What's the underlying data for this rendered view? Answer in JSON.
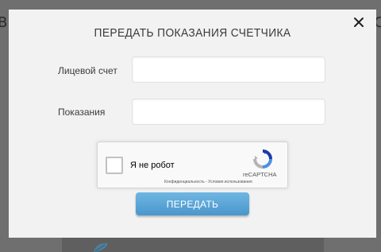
{
  "backdrop": {
    "left_fragment": "В",
    "right_fragment": "С"
  },
  "modal": {
    "title": "ПЕРЕДАТЬ ПОКАЗАНИЯ СЧЕТЧИКА",
    "close_icon": "close-icon",
    "fields": [
      {
        "label": "Лицевой счет",
        "value": "",
        "placeholder": ""
      },
      {
        "label": "Показания",
        "value": "",
        "placeholder": ""
      }
    ],
    "recaptcha": {
      "label": "Я не робот",
      "brand": "reCAPTCHA",
      "links": "Конфиденциальность - Условия использования",
      "checked": false
    },
    "submit_label": "ПЕРЕДАТЬ"
  },
  "colors": {
    "overlay": "#6f6f6f",
    "modal_bg": "#f2f2f2",
    "button": "#5aa6d8",
    "recaptcha_blue": "#4a90e2",
    "recaptcha_dark": "#1c3aa9"
  }
}
